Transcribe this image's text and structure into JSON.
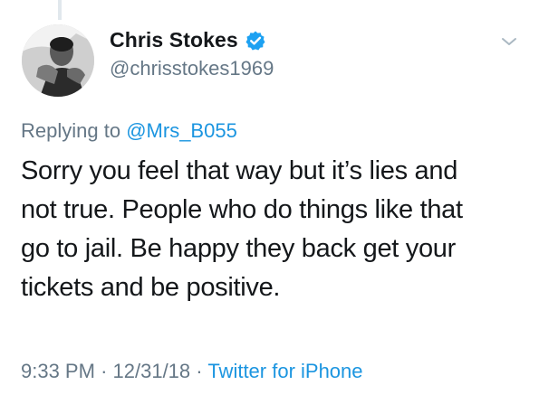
{
  "tweet": {
    "author": {
      "display_name": "Chris Stokes",
      "handle": "@chrisstokes1969",
      "verified": true
    },
    "reply_prefix": "Replying to",
    "reply_mention": "@Mrs_B055",
    "text_lines": [
      "Sorry you feel that way but it’s lies and",
      "not true. People who do things like that",
      "go to jail. Be happy they back get your",
      "tickets and be positive."
    ],
    "time": "9:33 PM",
    "separator": "·",
    "date": "12/31/18",
    "source": "Twitter for iPhone"
  },
  "icons": {
    "verified": "verified-badge-icon",
    "menu": "chevron-down-icon",
    "avatar": "profile-photo"
  },
  "colors": {
    "accent": "#1da1f2",
    "link": "#1b95e0",
    "secondary_text": "#657786",
    "primary_text": "#14171a"
  }
}
